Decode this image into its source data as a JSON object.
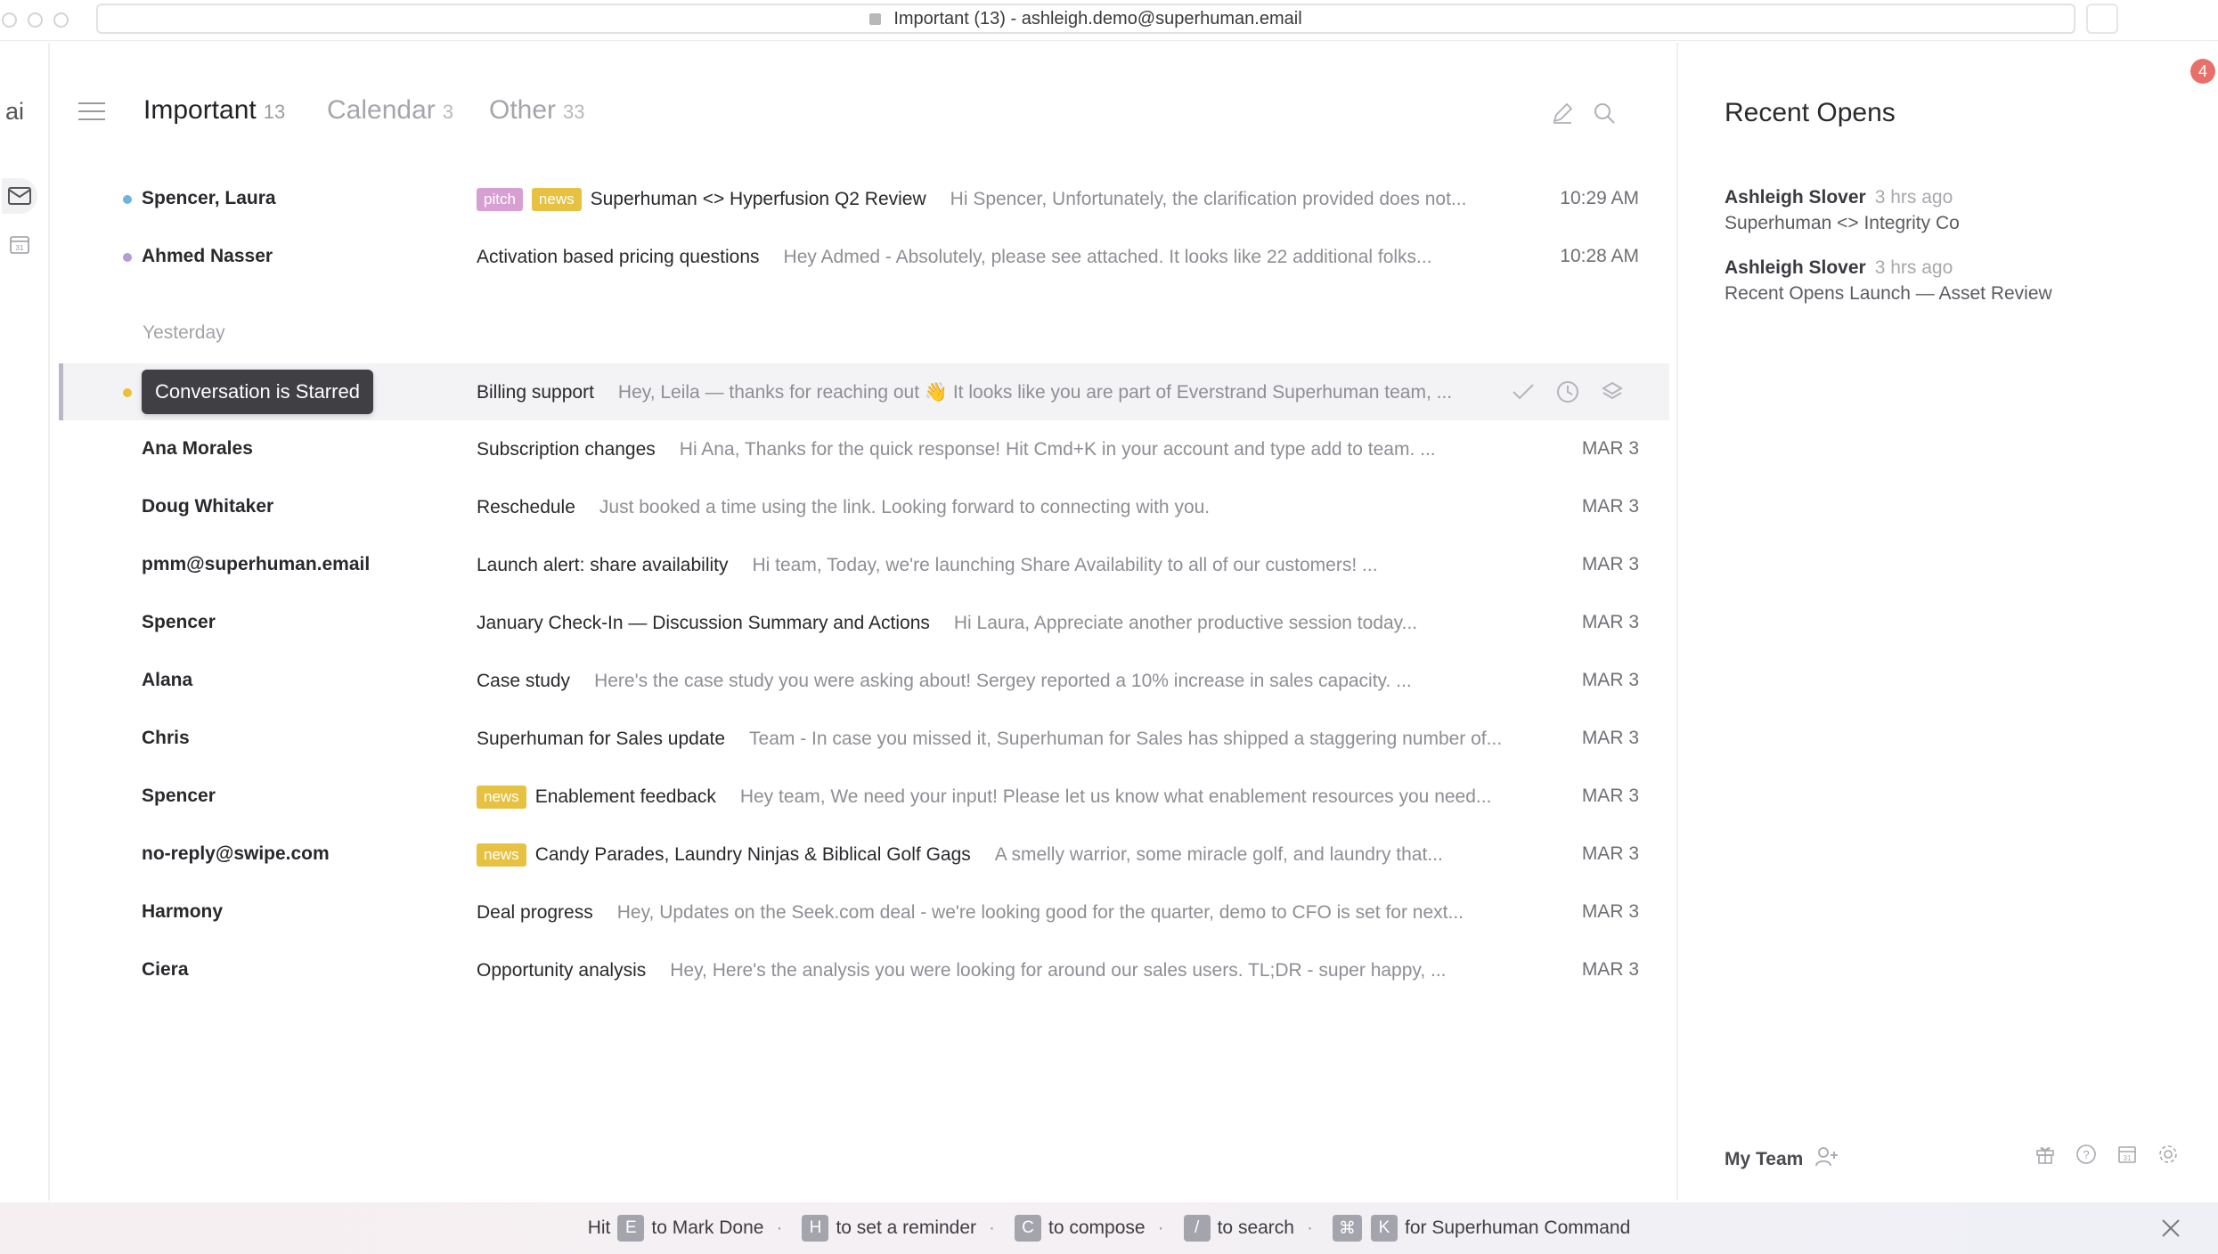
{
  "window": {
    "title": "Important (13) - ashleigh.demo@superhuman.email"
  },
  "rail": {
    "logo_text": "ai",
    "icons": [
      "mail-icon",
      "calendar-icon"
    ]
  },
  "tabs": [
    {
      "label": "Important",
      "count": "13"
    },
    {
      "label": "Calendar",
      "count": "3"
    },
    {
      "label": "Other",
      "count": "33"
    }
  ],
  "today_rows": [
    {
      "sender": "Spencer, Laura",
      "dot_color": "#6fb3e0",
      "badges": [
        "pitch",
        "news"
      ],
      "subject": "Superhuman <> Hyperfusion Q2 Review",
      "preview": "Hi Spencer, Unfortunately, the clarification provided does not...",
      "time": "10:29 AM"
    },
    {
      "sender": "Ahmed Nasser",
      "dot_color": "#b89ad8",
      "badges": [],
      "subject": "Activation based pricing questions",
      "preview": "Hey Admed - Absolutely, please see attached. It looks like 22 additional folks...",
      "time": "10:28 AM"
    }
  ],
  "section": {
    "yesterday_label": "Yesterday"
  },
  "selected_row": {
    "dot_color": "#e8c13a",
    "tooltip": "Conversation is Starred",
    "subject": "Billing support",
    "preview": "Hey, Leila — thanks for reaching out 👋 It looks like you are part of Everstrand Superhuman team, ...",
    "actions": [
      "check-icon",
      "clock-icon",
      "archive-icon"
    ]
  },
  "yesterday_rows": [
    {
      "sender": "Ana Morales",
      "badge": "",
      "subject": "Subscription changes",
      "preview": "Hi Ana, Thanks for the quick response! Hit Cmd+K in your account and type add to team. ...",
      "time": "MAR 3"
    },
    {
      "sender": "Doug Whitaker",
      "badge": "",
      "subject": "Reschedule",
      "preview": "Just booked a time using the link. Looking forward to connecting with you.",
      "time": "MAR 3"
    },
    {
      "sender": "pmm@superhuman.email",
      "badge": "",
      "subject": "Launch alert: share availability",
      "preview": "Hi team, Today, we're launching Share Availability to all of our customers! ...",
      "time": "MAR 3"
    },
    {
      "sender": "Spencer",
      "badge": "",
      "subject": "January Check-In — Discussion Summary and Actions",
      "preview": "Hi Laura, Appreciate another productive session today...",
      "time": "MAR 3"
    },
    {
      "sender": "Alana",
      "badge": "",
      "subject": "Case study",
      "preview": "Here's the case study you were asking about! Sergey reported a 10% increase in sales capacity. ...",
      "time": "MAR 3"
    },
    {
      "sender": "Chris",
      "badge": "",
      "subject": "Superhuman for Sales update",
      "preview": "Team - In case you missed it, Superhuman for Sales has shipped a staggering number of...",
      "time": "MAR 3"
    },
    {
      "sender": "Spencer",
      "badge": "news",
      "subject": "Enablement feedback",
      "preview": "Hey team, We need your input! Please let us know what enablement resources you need...",
      "time": "MAR 3"
    },
    {
      "sender": "no-reply@swipe.com",
      "badge": "news",
      "subject": "Candy Parades, Laundry Ninjas & Biblical Golf Gags",
      "preview": "A smelly warrior, some miracle golf, and laundry that...",
      "time": "MAR 3"
    },
    {
      "sender": "Harmony",
      "badge": "",
      "subject": "Deal progress",
      "preview": "Hey, Updates on the Seek.com deal - we're looking good for the quarter, demo to CFO is set for next...",
      "time": "MAR 3"
    },
    {
      "sender": "Ciera",
      "badge": "",
      "subject": "Opportunity analysis",
      "preview": "Hey, Here's the analysis you were looking for around our sales users. TL;DR - super happy, ...",
      "time": "MAR 3"
    }
  ],
  "right_panel": {
    "notification_count": "4",
    "title": "Recent Opens",
    "opens": [
      {
        "name": "Ashleigh Slover",
        "ago": "3 hrs ago",
        "subject": "Superhuman <> Integrity Co"
      },
      {
        "name": "Ashleigh Slover",
        "ago": "3 hrs ago",
        "subject": "Recent Opens Launch — Asset Review"
      }
    ],
    "team_label": "My Team",
    "footer_icons": [
      "gift-icon",
      "help-icon",
      "calendar-icon",
      "gear-icon"
    ]
  },
  "hints": {
    "prefix": "Hit",
    "items": [
      {
        "keys": [
          "E"
        ],
        "text": "to Mark Done"
      },
      {
        "keys": [
          "H"
        ],
        "text": "to set a reminder"
      },
      {
        "keys": [
          "C"
        ],
        "text": "to compose"
      },
      {
        "keys": [
          "/"
        ],
        "text": "to search"
      },
      {
        "keys": [
          "⌘",
          "K"
        ],
        "text": "for Superhuman Command"
      }
    ],
    "separator": "·"
  },
  "colors": {
    "accent_badge_pitch": "#d8a0d2",
    "accent_badge_news": "#e7c142",
    "notification": "#e9706a",
    "selected_row_bg": "#f3f3f6"
  }
}
